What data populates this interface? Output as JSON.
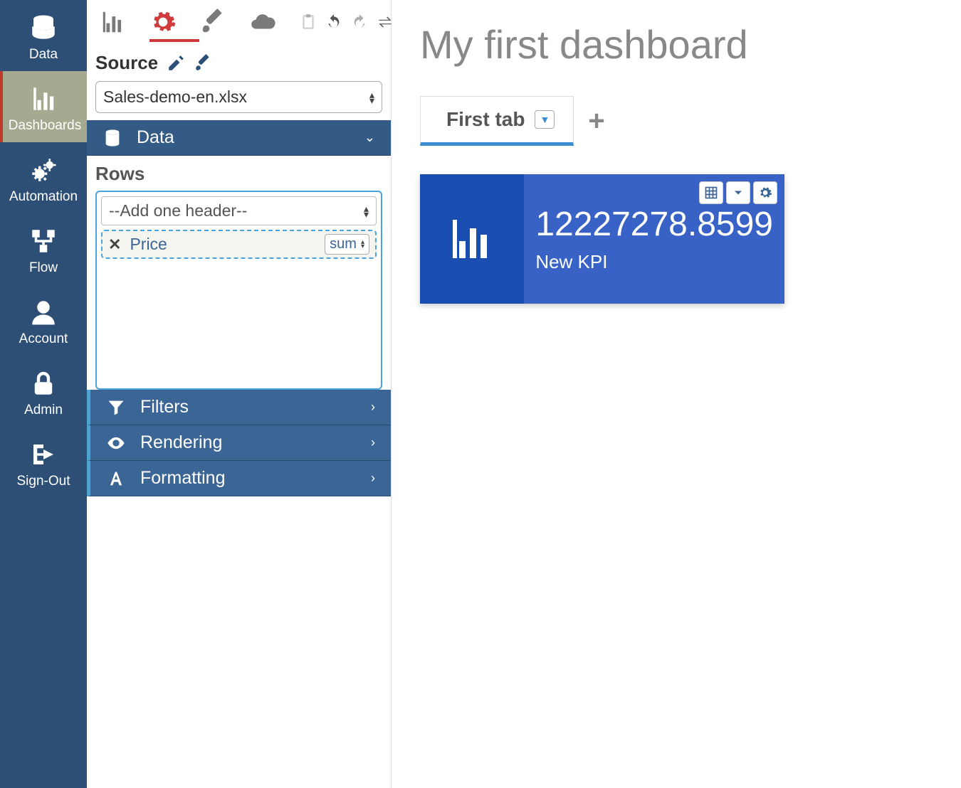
{
  "nav": {
    "items": [
      {
        "label": "Data"
      },
      {
        "label": "Dashboards"
      },
      {
        "label": "Automation"
      },
      {
        "label": "Flow"
      },
      {
        "label": "Account"
      },
      {
        "label": "Admin"
      },
      {
        "label": "Sign-Out"
      }
    ]
  },
  "config": {
    "source_label": "Source",
    "source_value": "Sales-demo-en.xlsx",
    "sections": {
      "data": "Data",
      "filters": "Filters",
      "rendering": "Rendering",
      "formatting": "Formatting"
    },
    "rows": {
      "title": "Rows",
      "add_placeholder": "--Add one header--",
      "items": [
        {
          "name": "Price",
          "agg": "sum"
        }
      ]
    }
  },
  "dashboard": {
    "title": "My first dashboard",
    "tabs": [
      {
        "label": "First tab"
      }
    ],
    "kpi": {
      "value": "12227278.8599",
      "name": "New KPI"
    }
  }
}
